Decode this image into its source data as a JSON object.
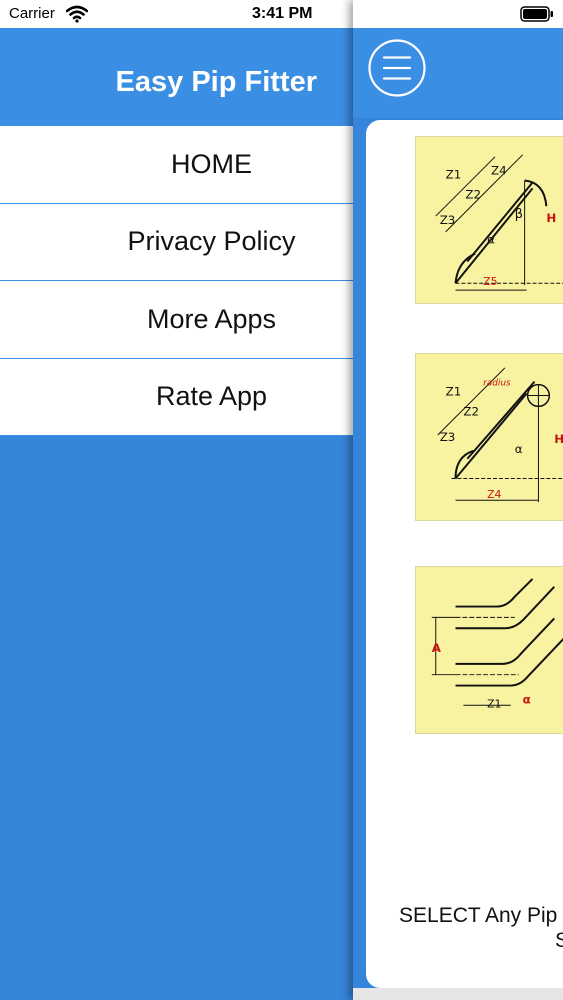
{
  "status_bar": {
    "carrier": "Carrier",
    "time": "3:41 PM",
    "wifi_icon": "wifi-icon",
    "battery_icon": "battery-icon"
  },
  "drawer": {
    "title": "Easy Pip Fitter",
    "menu": [
      {
        "label": "HOME"
      },
      {
        "label": "Privacy Policy"
      },
      {
        "label": "More Apps"
      },
      {
        "label": "Rate App"
      }
    ]
  },
  "main": {
    "menu_icon": "hamburger-menu-icon",
    "diagrams": [
      {
        "labels": [
          "Z1",
          "Z4",
          "Z2",
          "Z3",
          "α",
          "β",
          "H",
          "Z5"
        ]
      },
      {
        "labels": [
          "Z1",
          "radius",
          "Z2",
          "Z3",
          "α",
          "H",
          "Z4"
        ]
      },
      {
        "labels": [
          "A",
          "Z1",
          "α"
        ]
      }
    ],
    "instruction_line1": "SELECT Any Pip",
    "instruction_line2": "S"
  },
  "colors": {
    "drawer_blue": "#3585db",
    "header_blue": "#3a8ee3",
    "diagram_yellow": "#f8f3a0",
    "dimension_red": "#cc1111"
  }
}
